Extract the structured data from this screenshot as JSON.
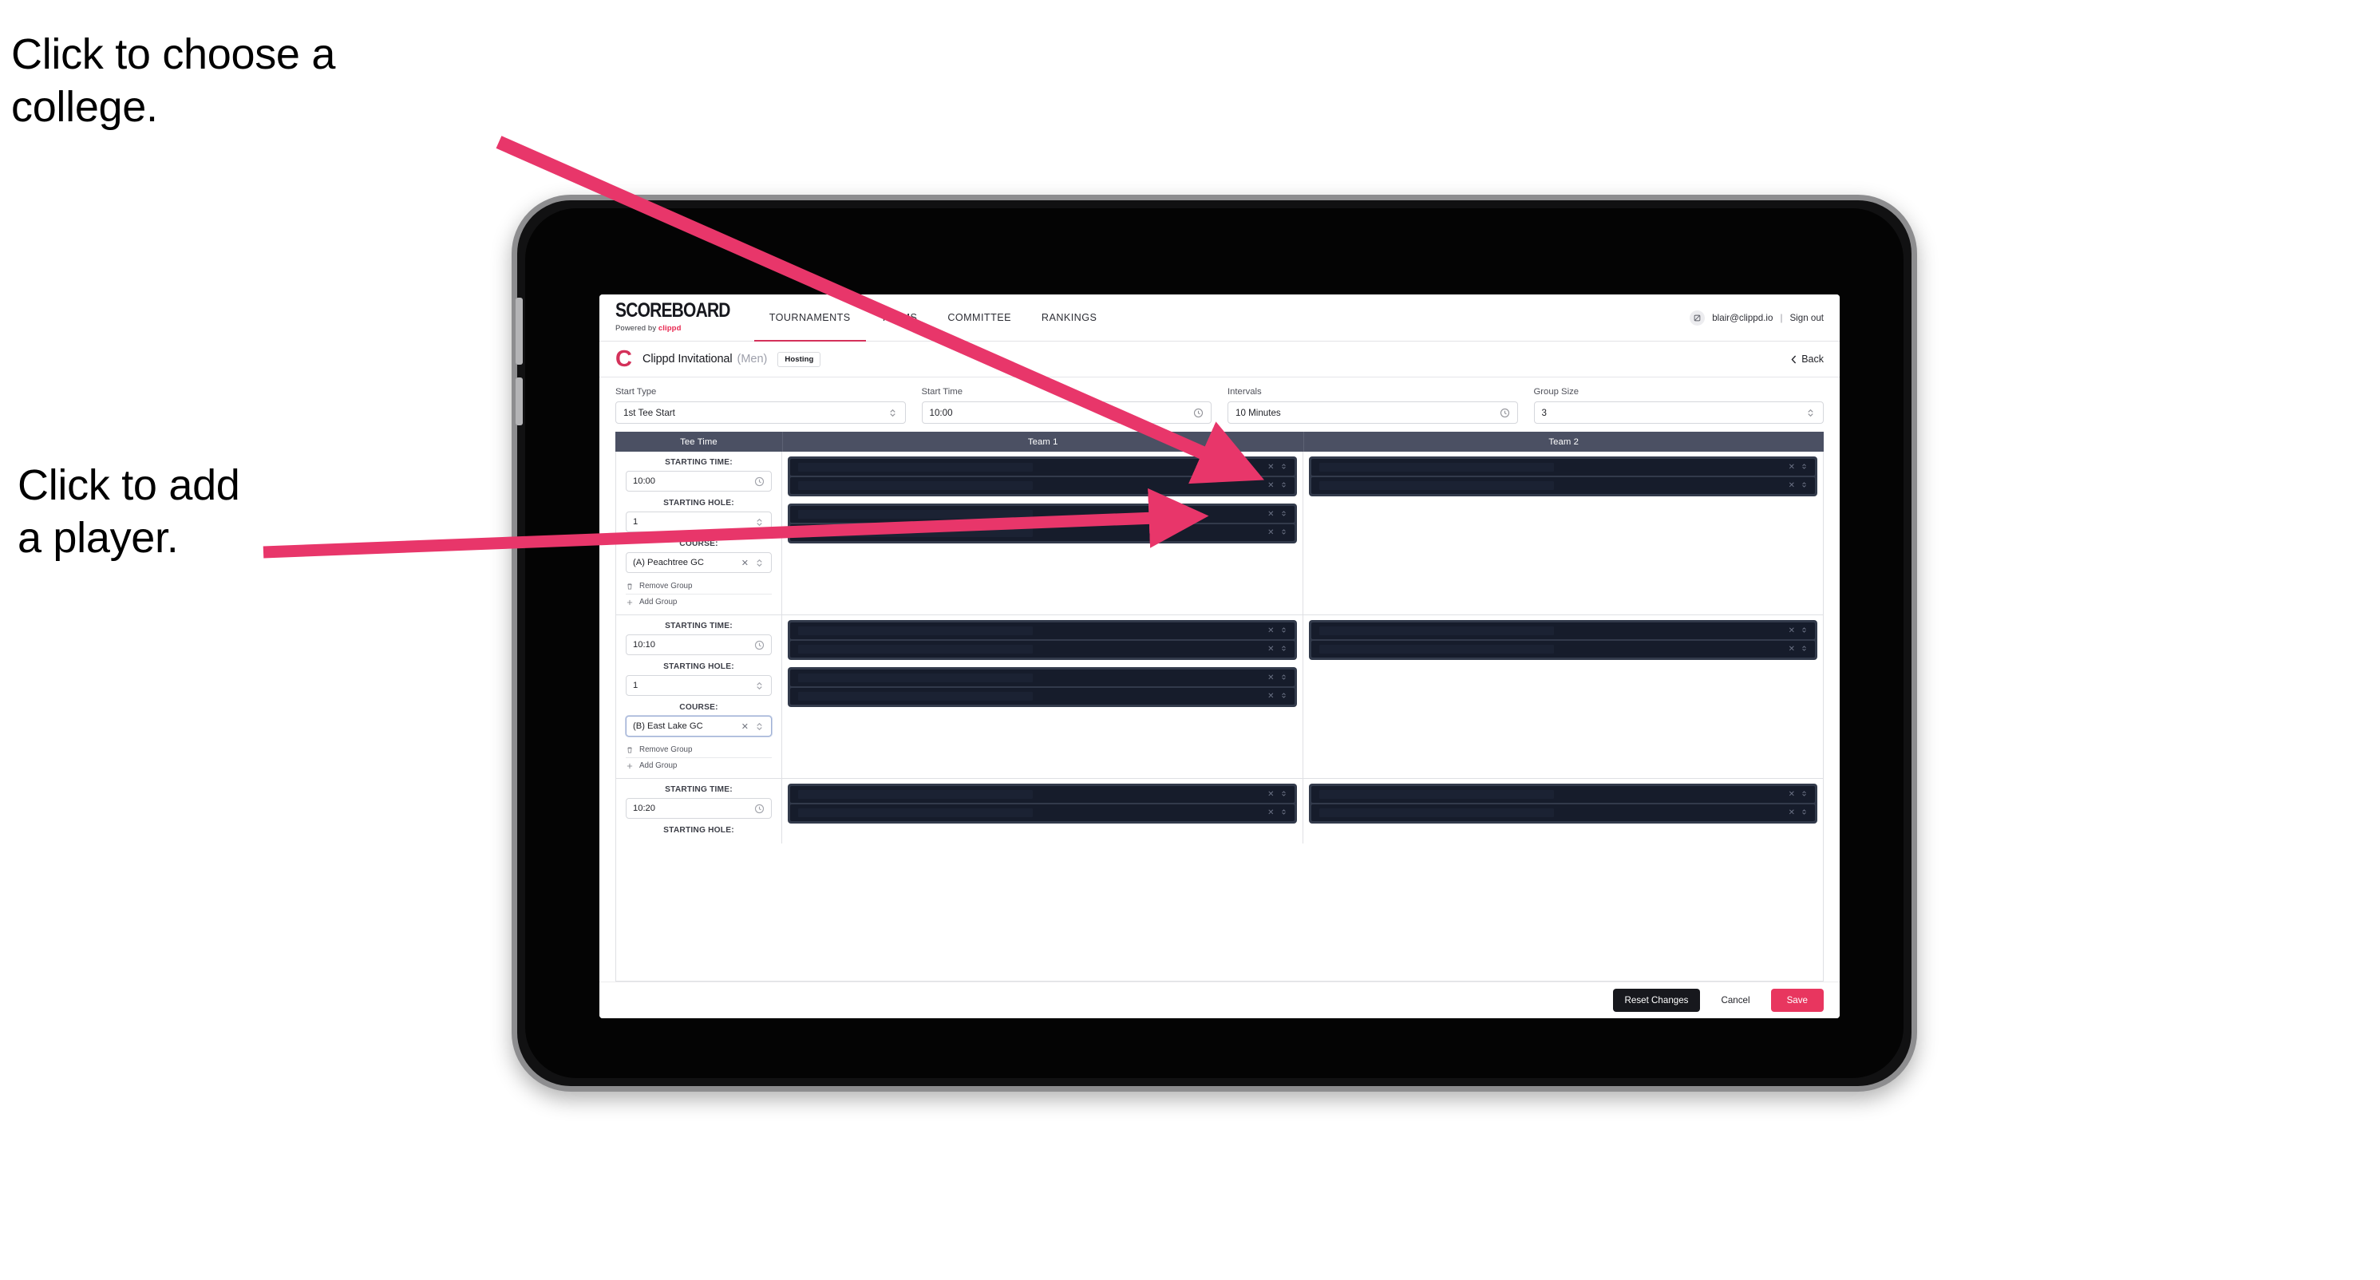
{
  "annotations": {
    "choose_college": "Click to choose a\ncollege.",
    "add_player": "Click to add\na player."
  },
  "colors": {
    "accent_pink": "#e8365f",
    "arrow_pink": "#e8366a",
    "nav_active_underline": "#d4315a",
    "table_header_bg": "#4b5063",
    "player_row_bg": "#161c2b",
    "group_box_bg": "#323a4b",
    "reset_button_bg": "#17181d"
  },
  "topnav": {
    "brand_word": "SCOREBOARD",
    "brand_sub_prefix": "Powered by",
    "brand_sub_brand": "clippd",
    "tabs": [
      {
        "label": "TOURNAMENTS",
        "active": true
      },
      {
        "label": "TEAMS",
        "active": false
      },
      {
        "label": "COMMITTEE",
        "active": false
      },
      {
        "label": "RANKINGS",
        "active": false
      }
    ],
    "avatar_icon": "user-avatar-icon",
    "user_email": "blair@clippd.io",
    "separator": "|",
    "sign_out": "Sign out"
  },
  "title_row": {
    "logo_letter": "C",
    "tournament_name": "Clippd Invitational",
    "gender": "(Men)",
    "badge": "Hosting",
    "back_label": "Back",
    "back_chevron": "chevron-left-icon"
  },
  "controls": [
    {
      "label": "Start Type",
      "value": "1st Tee Start",
      "icon": "stepper-updown-icon"
    },
    {
      "label": "Start Time",
      "value": "10:00",
      "icon": "clock-icon"
    },
    {
      "label": "Intervals",
      "value": "10 Minutes",
      "icon": "clock-icon"
    },
    {
      "label": "Group Size",
      "value": "3",
      "icon": "stepper-updown-icon"
    }
  ],
  "table": {
    "headers": {
      "tee_time": "Tee Time",
      "team1": "Team 1",
      "team2": "Team 2"
    },
    "labels": {
      "starting_time": "STARTING TIME:",
      "starting_hole": "STARTING HOLE:",
      "course": "COURSE:",
      "remove_group": "Remove Group",
      "add_group": "Add Group"
    },
    "blocks": [
      {
        "starting_time": "10:00",
        "starting_hole": "1",
        "course": "(A) Peachtree GC",
        "course_focused": false,
        "team1_groups": [
          2,
          2
        ],
        "team2_groups": [
          2
        ]
      },
      {
        "starting_time": "10:10",
        "starting_hole": "1",
        "course": "(B) East Lake GC",
        "course_focused": true,
        "team1_groups": [
          2,
          2
        ],
        "team2_groups": [
          2
        ]
      },
      {
        "starting_time": "10:20",
        "starting_hole": "",
        "course": "",
        "course_focused": false,
        "team1_groups": [
          2
        ],
        "team2_groups": [
          2
        ]
      }
    ]
  },
  "footer": {
    "reset": "Reset Changes",
    "cancel": "Cancel",
    "save": "Save"
  }
}
